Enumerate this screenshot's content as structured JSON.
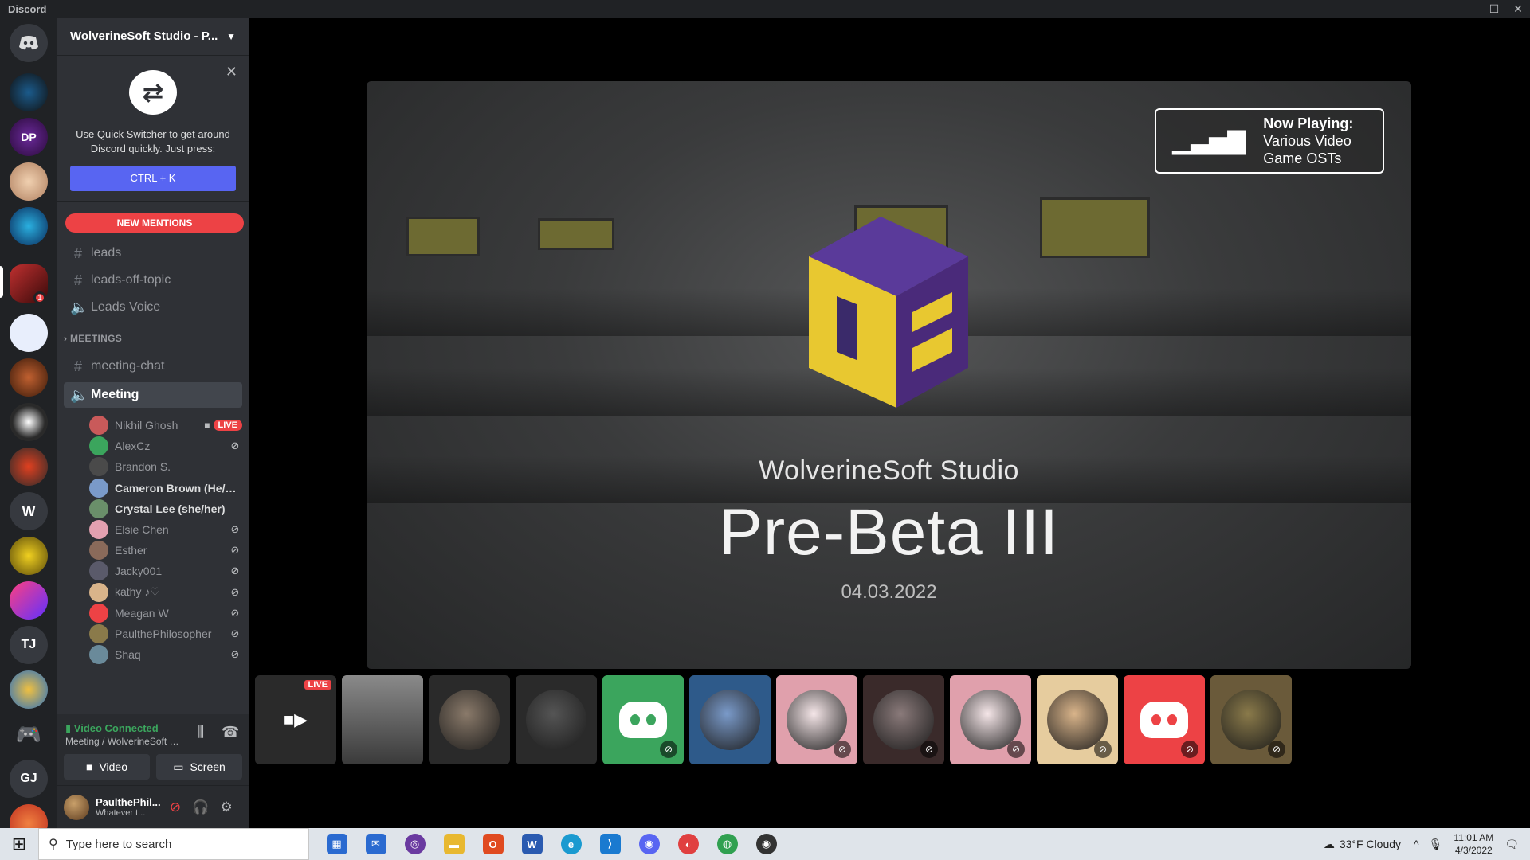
{
  "window": {
    "title": "Discord"
  },
  "server": {
    "name": "WolverineSoft Studio - P...",
    "guilds_letters": [
      "W",
      "TJ",
      "GJ"
    ],
    "notification_count": "1"
  },
  "quick_switcher": {
    "text": "Use Quick Switcher to get around Discord quickly. Just press:",
    "shortcut": "CTRL + K"
  },
  "new_mentions": "NEW MENTIONS",
  "channels": [
    {
      "type": "text",
      "name": "leads"
    },
    {
      "type": "text",
      "name": "leads-off-topic"
    },
    {
      "type": "voice",
      "name": "Leads Voice"
    }
  ],
  "category": "MEETINGS",
  "meeting_channels": [
    {
      "type": "text",
      "name": "meeting-chat"
    },
    {
      "type": "voice",
      "name": "Meeting",
      "active": true
    }
  ],
  "members": [
    {
      "name": "Nikhil Ghosh",
      "live": "LIVE",
      "camera": true,
      "muted": false,
      "color": "#c95a5a"
    },
    {
      "name": "AlexCz",
      "muted": true,
      "color": "#3ba55d"
    },
    {
      "name": "Brandon S.",
      "muted": false,
      "color": "#4a4a4a"
    },
    {
      "name": "Cameron Brown (He/Hi...",
      "muted": false,
      "bright": true,
      "color": "#7a9ac9"
    },
    {
      "name": "Crystal Lee (she/her)",
      "muted": false,
      "bright": true,
      "color": "#6a8f6a"
    },
    {
      "name": "Elsie Chen",
      "muted": true,
      "color": "#e3a0b0"
    },
    {
      "name": "Esther",
      "muted": true,
      "color": "#8a6a5a"
    },
    {
      "name": "Jacky001",
      "muted": true,
      "color": "#5a5a6a"
    },
    {
      "name": "kathy ♪♡",
      "muted": true,
      "color": "#d9b48a"
    },
    {
      "name": "Meagan W",
      "muted": true,
      "color": "#ed4245"
    },
    {
      "name": "PaulthePhilosopher",
      "muted": true,
      "color": "#8a7a4a"
    },
    {
      "name": "Shaq",
      "muted": true,
      "color": "#6a8a9a"
    }
  ],
  "voice_connection": {
    "status": "Video Connected",
    "location": "Meeting / WolverineSoft St...",
    "video_label": "Video",
    "screen_label": "Screen"
  },
  "user": {
    "name": "PaulthePhil...",
    "status": "Whatever t..."
  },
  "stream": {
    "now_playing_label": "Now Playing:",
    "now_playing_value": "Various Video Game OSTs",
    "studio": "WolverineSoft Studio",
    "event": "Pre-Beta III",
    "date": "04.03.2022"
  },
  "tiles": [
    {
      "kind": "screen",
      "live": "LIVE"
    },
    {
      "kind": "video"
    },
    {
      "kind": "avatar",
      "bg": "#2a2a2a",
      "color": "#8a7a6a"
    },
    {
      "kind": "avatar",
      "bg": "#2a2a2a",
      "color": "#555555"
    },
    {
      "kind": "discord",
      "bg": "#3ba55d"
    },
    {
      "kind": "avatar",
      "bg": "#2e5a8a",
      "color": "#7a9ac9"
    },
    {
      "kind": "avatar",
      "bg": "#e0a0ac",
      "color": "#f5e6e8"
    },
    {
      "kind": "avatar",
      "bg": "#3a2a2a",
      "color": "#8a7a7a"
    },
    {
      "kind": "avatar",
      "bg": "#e0a0ac",
      "color": "#f5e6e8"
    },
    {
      "kind": "avatar",
      "bg": "#e6cc9e",
      "color": "#d9b48a"
    },
    {
      "kind": "discord",
      "bg": "#ed4245"
    },
    {
      "kind": "avatar",
      "bg": "#6a5a3a",
      "color": "#8a7a4a"
    }
  ],
  "taskbar": {
    "search_placeholder": "Type here to search",
    "weather": "33°F  Cloudy",
    "time": "11:01 AM",
    "date": "4/3/2022"
  }
}
